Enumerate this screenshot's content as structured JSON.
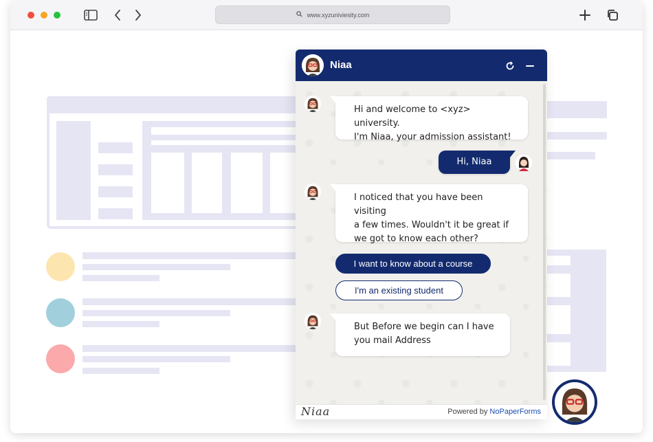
{
  "browser": {
    "url": "www.xyzuniviesity.com",
    "icons": [
      "sidebar-toggle-icon",
      "back-icon",
      "forward-icon",
      "search-icon",
      "new-tab-icon",
      "tabs-overview-icon"
    ]
  },
  "chat": {
    "agent_name": "Niaa",
    "header_icons": [
      "refresh-icon",
      "minimize-icon"
    ],
    "messages": [
      {
        "from": "bot",
        "line1": "Hi and welcome to <xyz> university.",
        "line2": "I'm Niaa, your admission assistant!"
      },
      {
        "from": "user",
        "text": "Hi, Niaa"
      },
      {
        "from": "bot",
        "line1": "I noticed that you have been visiting",
        "line2": "a few times. Wouldn't it be great if",
        "line3": "we got to know each other?"
      },
      {
        "from": "bot",
        "line1": "But Before we begin can I have",
        "line2": "you mail Address"
      }
    ],
    "quick_replies": [
      "I want to know about a course",
      "I'm an existing student"
    ],
    "footer": {
      "signature": "Niaa",
      "powered_prefix": "Powered by",
      "powered_brand": "NoPaperForms"
    }
  },
  "colors": {
    "brand_navy": "#132b6e",
    "skeleton": "#e6e5f4",
    "circle_yellow": "#fde5b0",
    "circle_teal": "#a1d0dc",
    "circle_pink": "#fba9ab"
  }
}
